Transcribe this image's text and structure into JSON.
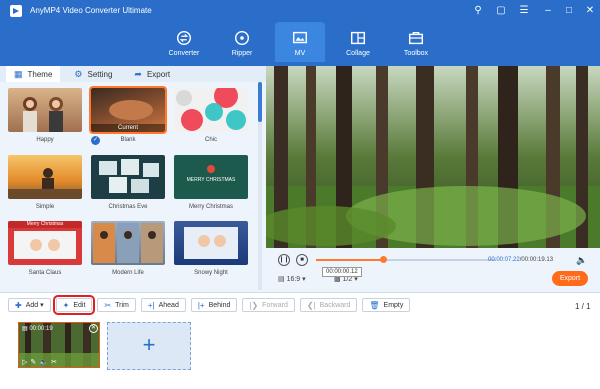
{
  "app": {
    "title": "AnyMP4 Video Converter Ultimate"
  },
  "nav": {
    "items": [
      {
        "label": "Converter",
        "icon": "converter-icon"
      },
      {
        "label": "Ripper",
        "icon": "ripper-icon"
      },
      {
        "label": "MV",
        "icon": "mv-icon"
      },
      {
        "label": "Collage",
        "icon": "collage-icon"
      },
      {
        "label": "Toolbox",
        "icon": "toolbox-icon"
      }
    ],
    "active": "MV"
  },
  "tabs": [
    {
      "label": "Theme",
      "icon": "theme-icon"
    },
    {
      "label": "Setting",
      "icon": "gear-icon"
    },
    {
      "label": "Export",
      "icon": "export-icon"
    }
  ],
  "themes": [
    {
      "label": "Happy"
    },
    {
      "label": "Blank",
      "overlay": "Current",
      "selected": true
    },
    {
      "label": "Chic"
    },
    {
      "label": "Simple"
    },
    {
      "label": "Christmas Eve"
    },
    {
      "label": "Merry Christmas",
      "card_text": "MERRY CHRISTMAS"
    },
    {
      "label": "Santa Claus",
      "card_text": "Merry Christmas"
    },
    {
      "label": "Modern Life"
    },
    {
      "label": "Snowy Night"
    }
  ],
  "player": {
    "current_time": "00:00:07.22",
    "total_time": "00:00:19.13",
    "time_sep": "/",
    "progress": 0.37,
    "aspect": "16:9",
    "scale": "1/2",
    "tooltip": "00:00:00.12",
    "export_label": "Export"
  },
  "toolbar": {
    "add": "Add",
    "edit": "Edit",
    "trim": "Trim",
    "ahead": "Ahead",
    "behind": "Behind",
    "forward": "Forward",
    "backward": "Backward",
    "empty": "Empty"
  },
  "page": {
    "indicator": "1 / 1"
  },
  "clip": {
    "duration": "00:00:19"
  },
  "colors": {
    "brand": "#2a6ec9",
    "accent": "#ff6b1a",
    "highlight": "#e02020"
  }
}
